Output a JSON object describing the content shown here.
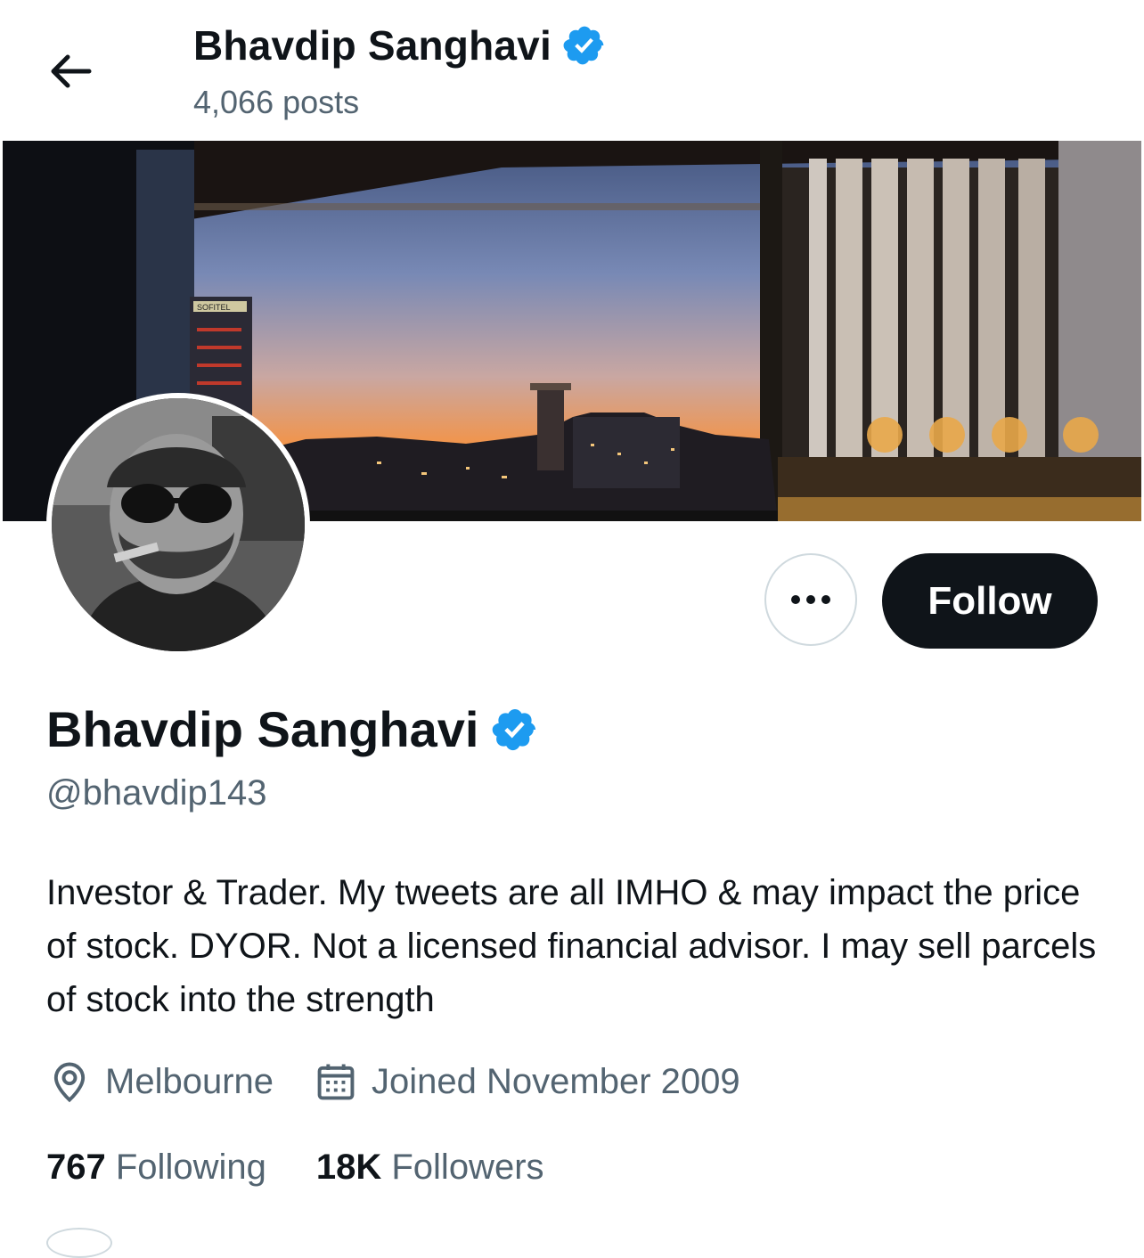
{
  "header": {
    "title": "Bhavdip Sanghavi",
    "post_count": "4,066 posts"
  },
  "banner": {
    "sign_text": "SOFITEL",
    "colors": {
      "sky_top": "#5a6fa0",
      "sky_mid": "#c3a8a8",
      "sky_horizon": "#f08a3c"
    }
  },
  "actions": {
    "more_label": "•••",
    "follow_label": "Follow"
  },
  "profile": {
    "name": "Bhavdip Sanghavi",
    "handle": "@bhavdip143",
    "bio": "Investor & Trader. My tweets are all IMHO & may impact the price of stock. DYOR. Not a licensed financial advisor. I may sell parcels of stock into the strength",
    "location": "Melbourne",
    "joined": "Joined November 2009"
  },
  "stats": {
    "following_count": "767",
    "following_label": "Following",
    "followers_count": "18K",
    "followers_label": "Followers"
  },
  "icons": {
    "back": "arrow-left-icon",
    "verified": "verified-badge-icon",
    "location": "map-pin-icon",
    "calendar": "calendar-icon"
  },
  "theme": {
    "verified_color": "#1d9bf0",
    "text_primary": "#0f1419",
    "text_secondary": "#536471"
  }
}
